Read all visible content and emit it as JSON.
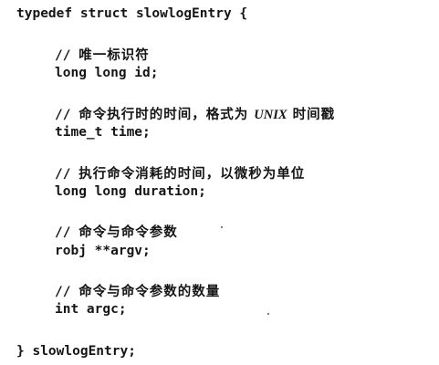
{
  "code": {
    "open_line": "typedef struct slowlogEntry {",
    "fields": [
      {
        "comment_prefix": "// ",
        "comment_text": "唯一标识符",
        "declaration": "long long id;"
      },
      {
        "comment_prefix": "// ",
        "comment_text_a": "命令执行时的时间，格式为 ",
        "comment_em": "UNIX",
        "comment_text_b": " 时间戳",
        "declaration": "time_t time;"
      },
      {
        "comment_prefix": "// ",
        "comment_text": "执行命令消耗的时间，以微秒为单位",
        "declaration": "long long duration;"
      },
      {
        "comment_prefix": "// ",
        "comment_text": "命令与命令参数",
        "declaration": "robj **argv;"
      },
      {
        "comment_prefix": "// ",
        "comment_text": "命令与命令参数的数量",
        "declaration": "int argc;"
      }
    ],
    "close_line": "} slowlogEntry;"
  }
}
